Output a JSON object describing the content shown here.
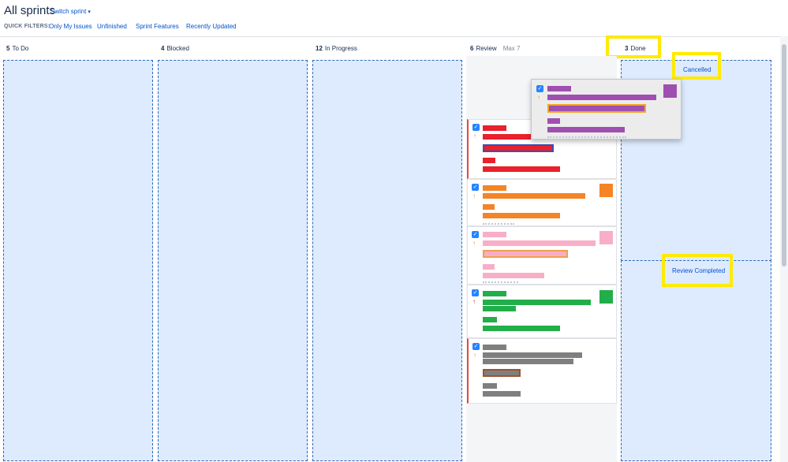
{
  "header": {
    "title": "All sprints",
    "switch_sprint": "Switch sprint"
  },
  "quick_filters": {
    "label": "QUICK FILTERS:",
    "items": [
      "Only My Issues",
      "Unfinished",
      "Sprint Features",
      "Recently Updated"
    ]
  },
  "columns": [
    {
      "count": "5",
      "name": "To Do"
    },
    {
      "count": "4",
      "name": "Blocked"
    },
    {
      "count": "12",
      "name": "In Progress"
    },
    {
      "count": "6",
      "name": "Review",
      "max": "Max 7"
    },
    {
      "count": "3",
      "name": "Done"
    }
  ],
  "done_zones": {
    "cancelled": "Cancelled",
    "review_completed": "Review Completed"
  },
  "colors": {
    "drop_zone": "#deebff",
    "highlight": "#ffea00",
    "purple": "#9f4fb0",
    "red": "#e8212c",
    "orange": "#f58426",
    "pink": "#f9aec8",
    "green": "#22ae4a",
    "gray": "#7f7f7f"
  }
}
